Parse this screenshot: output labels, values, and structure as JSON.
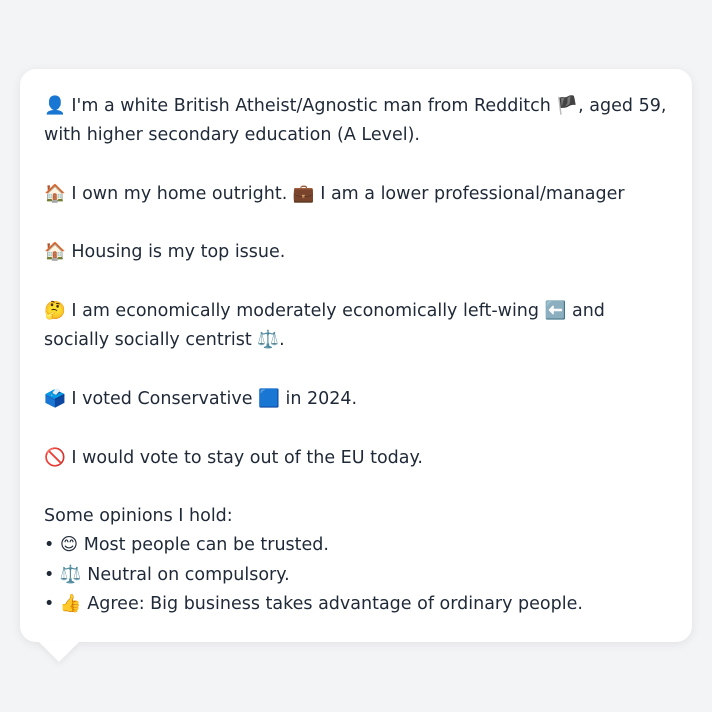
{
  "profile": {
    "identity": {
      "emoji": "👤",
      "text_1": "I'm a white British Atheist/Agnostic man from Redditch",
      "flag": "🏴",
      "text_2": ", aged 59, with higher secondary education (A Level)."
    },
    "home": {
      "emoji_home": "🏠",
      "text_home": "I own my home outright.",
      "emoji_job": "💼",
      "text_job": "I am a lower professional/manager"
    },
    "issue": {
      "emoji": "🏠",
      "text": "Housing is my top issue."
    },
    "ideology": {
      "emoji": "🤔",
      "text_1": "I am economically moderately economically left-wing",
      "emoji_left": "⬅️",
      "text_2": "and socially socially centrist",
      "emoji_scale": "⚖️",
      "text_3": "."
    },
    "vote": {
      "emoji": "🗳️",
      "text_1": "I voted Conservative",
      "emoji_party": "🟦",
      "text_2": "in 2024."
    },
    "eu": {
      "emoji": "🚫",
      "text": "I would vote to stay out of the EU today."
    },
    "opinions": {
      "heading": "Some opinions I hold:",
      "bullet": "•",
      "items": [
        {
          "emoji": "😊",
          "text": "Most people can be trusted."
        },
        {
          "emoji": "⚖️",
          "text": "Neutral on compulsory."
        },
        {
          "emoji": "👍",
          "text": "Agree: Big business takes advantage of ordinary people."
        }
      ]
    }
  },
  "colors": {
    "page_background": "#f3f4f6",
    "bubble_background": "#ffffff",
    "text": "#1f2937"
  }
}
